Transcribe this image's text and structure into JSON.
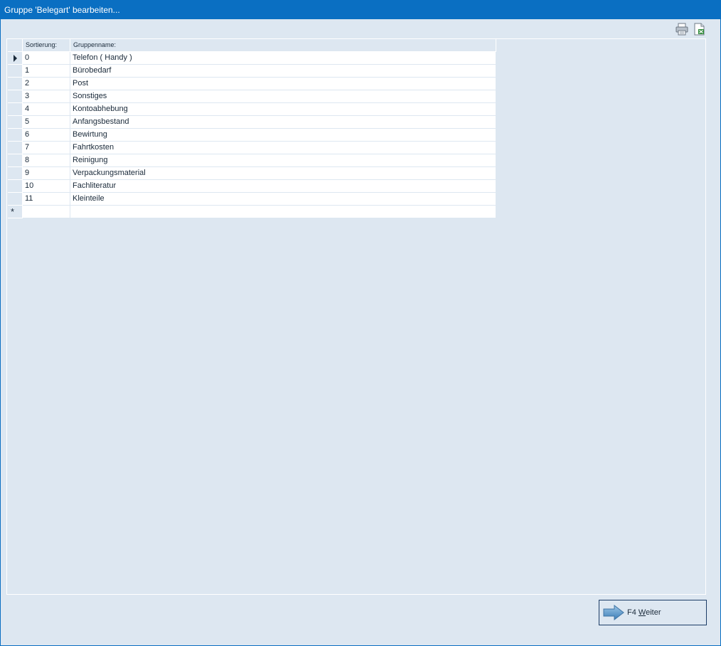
{
  "window": {
    "title": "Gruppe 'Belegart' bearbeiten..."
  },
  "toolbar": {
    "print_icon": "printer-icon",
    "export_icon": "export-excel-icon"
  },
  "grid": {
    "columns": [
      "Sortierung:",
      "Gruppenname:"
    ],
    "rows": [
      {
        "sort": "0",
        "name": "Telefon ( Handy )"
      },
      {
        "sort": "1",
        "name": "Bürobedarf"
      },
      {
        "sort": "2",
        "name": "Post"
      },
      {
        "sort": "3",
        "name": "Sonstiges"
      },
      {
        "sort": "4",
        "name": "Kontoabhebung"
      },
      {
        "sort": "5",
        "name": "Anfangsbestand"
      },
      {
        "sort": "6",
        "name": "Bewirtung"
      },
      {
        "sort": "7",
        "name": "Fahrtkosten"
      },
      {
        "sort": "8",
        "name": "Reinigung"
      },
      {
        "sort": "9",
        "name": "Verpackungsmaterial"
      },
      {
        "sort": "10",
        "name": "Fachliteratur"
      },
      {
        "sort": "11",
        "name": "Kleinteile"
      }
    ],
    "new_row_marker": "*"
  },
  "footer": {
    "weiter_key": "F4",
    "weiter_mnemonic": "W",
    "weiter_rest": "eiter",
    "weiter_icon": "arrow-right-icon"
  },
  "colors": {
    "titlebar": "#0a6fc2",
    "background": "#dde7f1"
  }
}
